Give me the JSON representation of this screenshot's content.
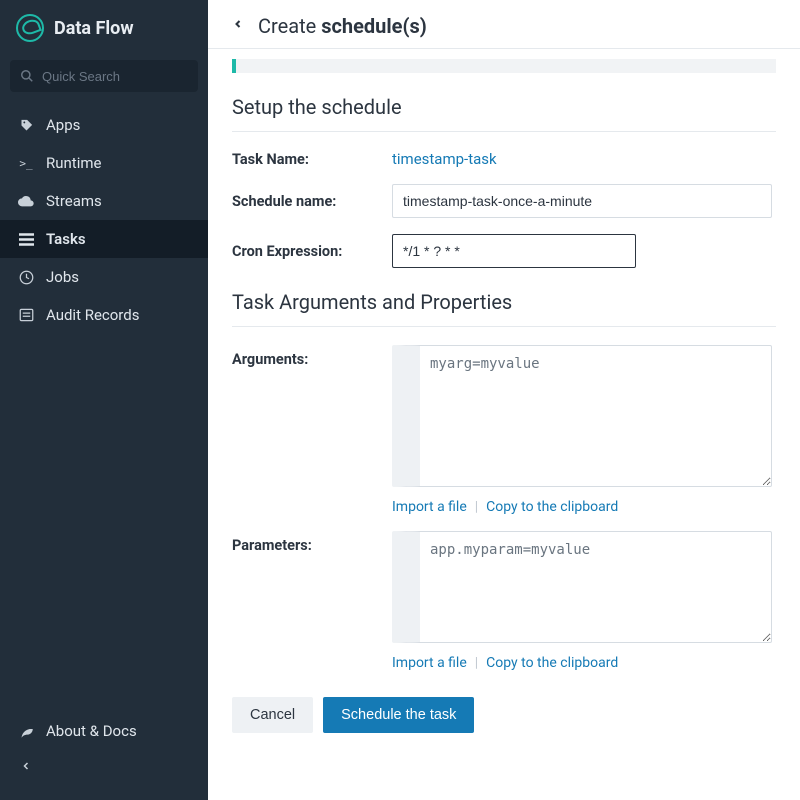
{
  "brand": "Data Flow",
  "search": {
    "placeholder": "Quick Search"
  },
  "nav": {
    "apps": "Apps",
    "runtime": "Runtime",
    "streams": "Streams",
    "tasks": "Tasks",
    "jobs": "Jobs",
    "audit": "Audit Records"
  },
  "footer": {
    "about": "About & Docs"
  },
  "header": {
    "prefix": "Create ",
    "strong": "schedule(s)"
  },
  "sections": {
    "setup": "Setup the schedule",
    "args": "Task Arguments and Properties"
  },
  "labels": {
    "task_name": "Task Name:",
    "schedule_name": "Schedule name:",
    "cron": "Cron Expression:",
    "arguments": "Arguments:",
    "parameters": "Parameters:"
  },
  "values": {
    "task_name": "timestamp-task",
    "schedule_name": "timestamp-task-once-a-minute",
    "cron": "*/1 * ? * *",
    "arguments": "myarg=myvalue",
    "parameters": "app.myparam=myvalue"
  },
  "actions": {
    "import": "Import a file",
    "copy": "Copy to the clipboard",
    "cancel": "Cancel",
    "schedule": "Schedule the task"
  }
}
